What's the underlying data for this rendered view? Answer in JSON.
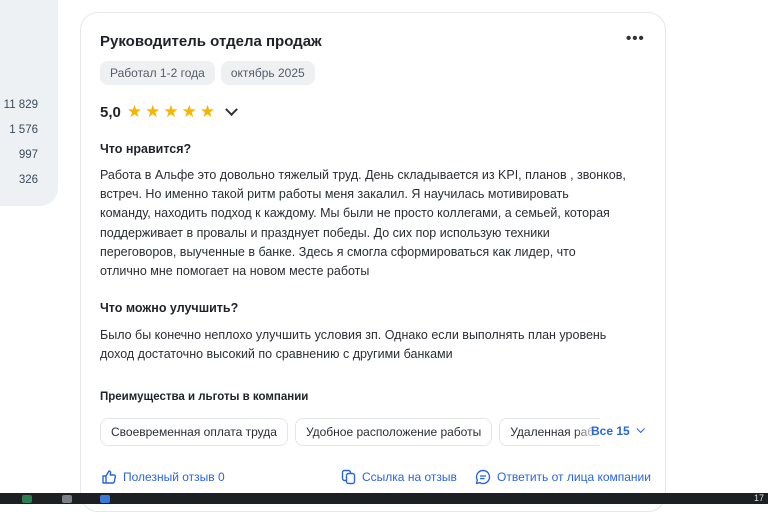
{
  "left_counts": [
    "11 829",
    "1 576",
    "997",
    "326"
  ],
  "review": {
    "position": "Руководитель отдела продаж",
    "more_icon": "•••",
    "tags": [
      "Работал 1-2 года",
      "октябрь 2025"
    ],
    "rating": {
      "value": "5,0",
      "stars": 5
    },
    "likes_title": "Что нравится?",
    "likes_lines": [
      "Работа в Альфе это довольно тяжелый труд. День складывается из KPI, планов , звонков,",
      "встреч. Но именно такой ритм работы меня закалил. Я научилась мотивировать",
      "команду, находить подход к каждому. Мы были не просто коллегами, а семьей, которая",
      "поддерживает в провалы и празднует победы. До сих пор использую техники",
      "переговоров, выученные в банке. Здесь я смогла сформироваться как лидер, что",
      "отлично мне помогает на новом месте работы"
    ],
    "improve_title": "Что можно улучшить?",
    "improve_lines": [
      "Было бы конечно неплохо улучшить условия зп. Однако если выполнять план уровень",
      "доход достаточно высокий по сравнению с другими банками"
    ],
    "perks_title": "Преимущества и льготы в компании",
    "perks": [
      "Своевременная оплата труда",
      "Удобное расположение работы",
      "Удаленная раб"
    ],
    "all_perks_label": "Все 15",
    "actions": {
      "helpful": "Полезный отзыв 0",
      "link": "Ссылка на отзыв",
      "reply": "Ответить от лица компании"
    }
  },
  "taskbar": {
    "time": "17"
  },
  "colors": {
    "accent": "#2a66d8",
    "star": "#f7b500"
  }
}
